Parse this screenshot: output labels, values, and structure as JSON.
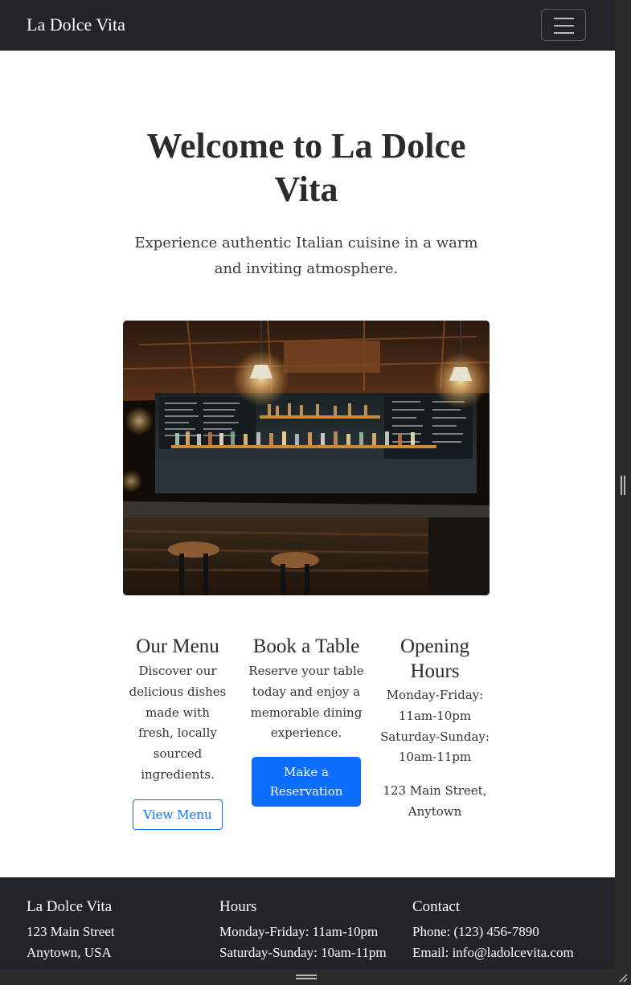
{
  "navbar": {
    "brand": "La Dolce Vita"
  },
  "hero": {
    "title": "Welcome to La Dolce Vita",
    "subtitle": "Experience authentic Italian cuisine in a warm and inviting atmosphere."
  },
  "features": {
    "menu": {
      "title": "Our Menu",
      "text": "Discover our delicious dishes made with fresh, locally sourced ingredients.",
      "button": "View Menu"
    },
    "booking": {
      "title": "Book a Table",
      "text": "Reserve your table today and enjoy a memorable dining experience.",
      "button": "Make a Reservation"
    },
    "hours": {
      "title": "Opening Hours",
      "weekday": "Monday-Friday: 11am-10pm",
      "weekend": "Saturday-Sunday: 10am-11pm",
      "address": "123 Main Street, Anytown"
    }
  },
  "footer": {
    "about": {
      "title": "La Dolce Vita",
      "line1": "123 Main Street",
      "line2": "Anytown, USA"
    },
    "hours": {
      "title": "Hours",
      "line1": "Monday-Friday: 11am-10pm",
      "line2": "Saturday-Sunday: 10am-11pm"
    },
    "contact": {
      "title": "Contact",
      "line1": "Phone: (123) 456-7890",
      "line2": "Email: info@ladolcevita.com"
    }
  },
  "colors": {
    "navbar_bg": "#212529",
    "primary": "#0d6efd",
    "text": "#212529"
  }
}
